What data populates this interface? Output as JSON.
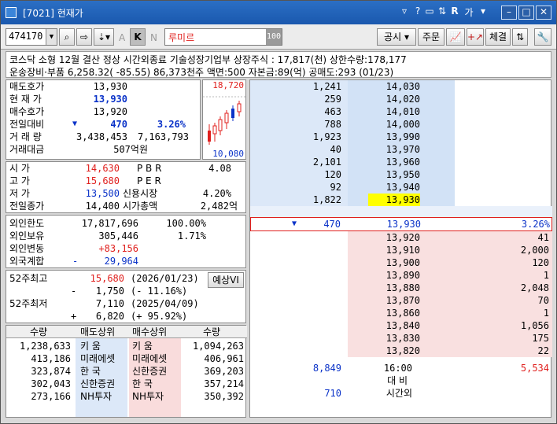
{
  "title": "[7021] 현재가",
  "window_controls": [
    "?",
    "R",
    "가"
  ],
  "toolbar": {
    "code": "474170",
    "name": "루미르",
    "tag_a": "A",
    "tag_k": "K",
    "tag_n": "N",
    "count": "100",
    "buttons": [
      "공시",
      "주문",
      "체결"
    ]
  },
  "info": {
    "line1": "코스닥 소형 12월 결산  정상    시간외종료 기술성장기업부 상장주식 : 17,817(천) 상한수량:178,177",
    "line2": "운송장비·부품  6,258.32( -85.55) 86,373천주 액면:500 자본금:89(억) 공매도:293 (01/23)"
  },
  "quote": {
    "rows": [
      {
        "label": "매도호가",
        "value": "13,930",
        "extra": ""
      },
      {
        "label": "현 재 가",
        "value": "13,930",
        "extra": ""
      },
      {
        "label": "매수호가",
        "value": "13,920",
        "extra": ""
      },
      {
        "label": "전일대비",
        "value": "470",
        "extra": "3.26%"
      },
      {
        "label": "거 래 량",
        "value": "3,438,453",
        "extra": "7,163,793"
      },
      {
        "label": "거래대금",
        "value": "507억원",
        "extra": ""
      }
    ],
    "chart_high": "18,720",
    "chart_low": "10,080"
  },
  "price": {
    "rows": [
      {
        "label": "시      가",
        "value": "14,630",
        "label2": "P B R",
        "value2": "4.08"
      },
      {
        "label": "고      가",
        "value": "15,680",
        "label2": "P E R",
        "value2": ""
      },
      {
        "label": "저      가",
        "value": "13,500",
        "label2": "신용시장",
        "value2": "4.20%"
      },
      {
        "label": "전일종가",
        "value": "14,400",
        "label2": "시가총액",
        "value2": "2,482억"
      }
    ]
  },
  "foreign": {
    "rows": [
      {
        "label": "외인한도",
        "value": "17,817,696",
        "extra": "100.00%"
      },
      {
        "label": "외인보유",
        "value": "305,446",
        "extra": "1.71%"
      },
      {
        "label": "외인변동",
        "value": "+83,156",
        "extra": ""
      },
      {
        "label": "외국계합",
        "value": "29,964",
        "sign": "-",
        "extra": ""
      }
    ]
  },
  "week52": {
    "high_label": "52주최고",
    "high_value": "15,680",
    "high_date": "(2026/01/23)",
    "high_diff": "1,750",
    "high_diff_sign": "-",
    "high_pct": "(-   11.16%)",
    "low_label": "52주최저",
    "low_value": "7,110",
    "low_date": "(2025/04/09)",
    "low_diff": "6,820",
    "low_diff_sign": "+",
    "low_pct": "(+   95.92%)",
    "forecast_button": "예상VI"
  },
  "brokers": {
    "headers": [
      "수량",
      "매도상위",
      "매수상위",
      "수량"
    ],
    "rows": [
      {
        "sell_qty": "1,238,633",
        "sell": "키    움",
        "buy": "키    움",
        "buy_qty": "1,094,263"
      },
      {
        "sell_qty": "413,186",
        "sell": "미래에셋",
        "buy": "미래에셋",
        "buy_qty": "406,961"
      },
      {
        "sell_qty": "323,874",
        "sell": "한    국",
        "buy": "신한증권",
        "buy_qty": "369,203"
      },
      {
        "sell_qty": "302,043",
        "sell": "신한증권",
        "buy": "한    국",
        "buy_qty": "357,214"
      },
      {
        "sell_qty": "273,166",
        "sell": "NH투자",
        "buy": "NH투자",
        "buy_qty": "350,392"
      }
    ]
  },
  "orderbook": {
    "asks": [
      {
        "qty": "1,241",
        "price": "14,030"
      },
      {
        "qty": "259",
        "price": "14,020"
      },
      {
        "qty": "463",
        "price": "14,010"
      },
      {
        "qty": "788",
        "price": "14,000"
      },
      {
        "qty": "1,923",
        "price": "13,990"
      },
      {
        "qty": "40",
        "price": "13,970"
      },
      {
        "qty": "2,101",
        "price": "13,960"
      },
      {
        "qty": "120",
        "price": "13,950"
      },
      {
        "qty": "92",
        "price": "13,940"
      },
      {
        "qty": "1,822",
        "price": "13,930"
      }
    ],
    "current": {
      "change": "470",
      "price": "13,930",
      "pct": "3.26%"
    },
    "bids": [
      {
        "price": "13,920",
        "qty": "41"
      },
      {
        "price": "13,910",
        "qty": "2,000"
      },
      {
        "price": "13,900",
        "qty": "120"
      },
      {
        "price": "13,890",
        "qty": "1"
      },
      {
        "price": "13,880",
        "qty": "2,048"
      },
      {
        "price": "13,870",
        "qty": "70"
      },
      {
        "price": "13,860",
        "qty": "1"
      },
      {
        "price": "13,840",
        "qty": "1,056"
      },
      {
        "price": "13,830",
        "qty": "175"
      },
      {
        "price": "13,820",
        "qty": "22"
      }
    ],
    "total_ask": "8,849",
    "time": "16:00",
    "total_bid": "5,534",
    "label_compare": "대 비",
    "after_hours_qty": "710",
    "label_after_hours": "시간외"
  }
}
